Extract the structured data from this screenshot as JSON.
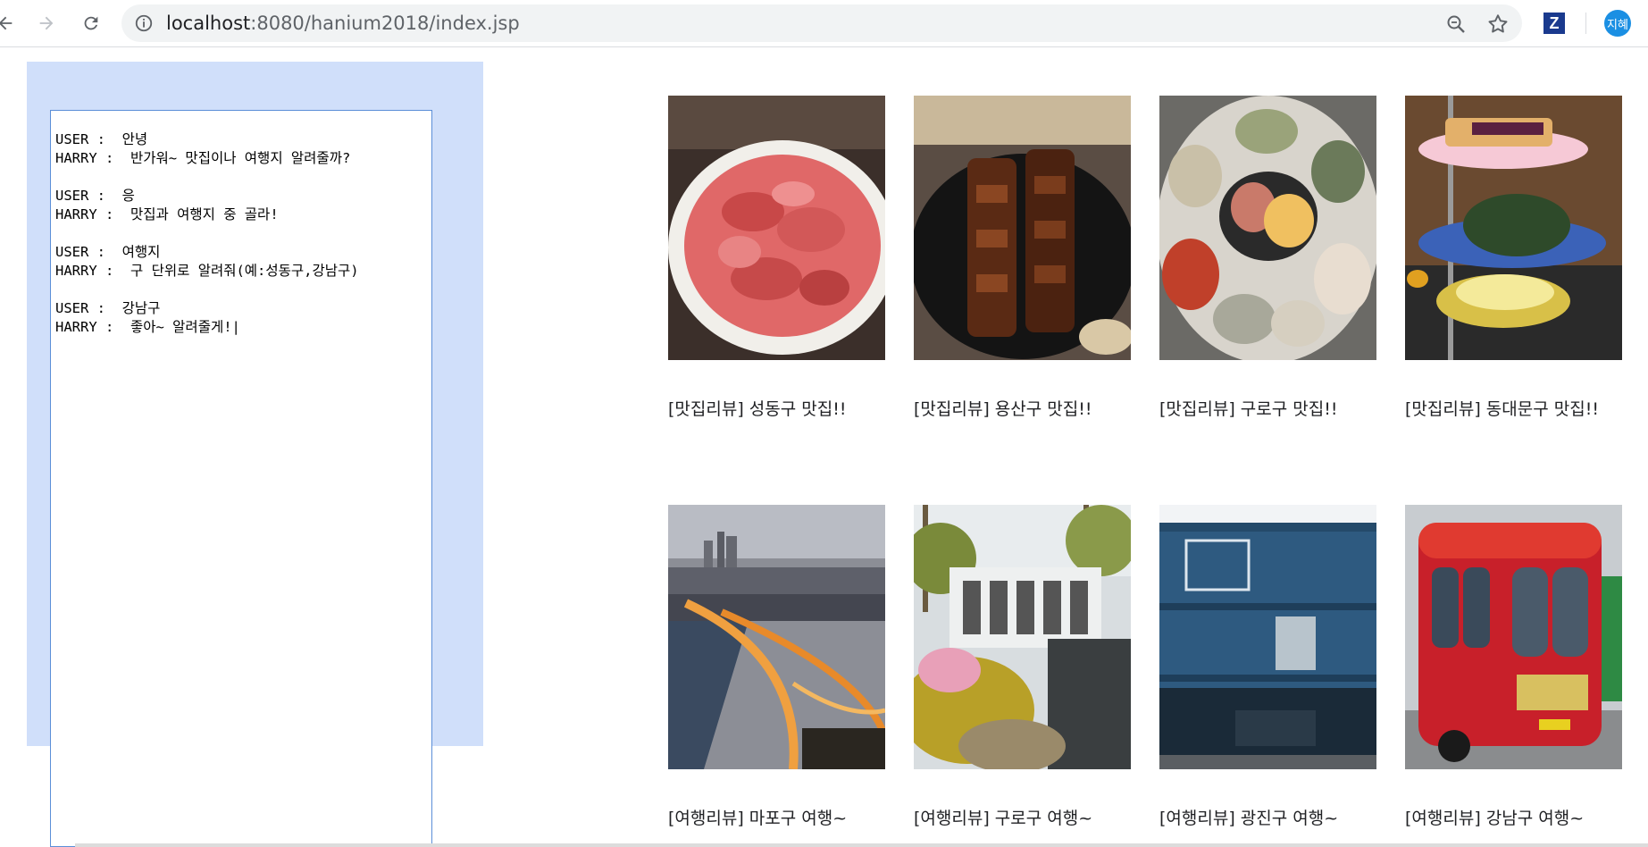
{
  "browser": {
    "url_host": "localhost",
    "url_path": ":8080/hanium2018/index.jsp",
    "extension_label": "Z",
    "profile_initials": "지혜"
  },
  "chat": {
    "lines": [
      "USER :  안녕",
      "HARRY :  반가워~ 맛집이나 여행지 알려줄까?",
      "",
      "USER :  응",
      "HARRY :  맛집과 여행지 중 골라!",
      "",
      "USER :  여행지",
      "HARRY :  구 단위로 알려줘(예:성동구,강남구)",
      "",
      "USER :  강남구",
      "HARRY :  좋아~ 알려줄게!|"
    ]
  },
  "food_reviews": [
    {
      "caption": "[맛집리뷰] 성동구 맛집!!",
      "photo": "raw-beef-plate"
    },
    {
      "caption": "[맛집리뷰] 용산구 맛집!!",
      "photo": "grilled-ribs"
    },
    {
      "caption": "[맛집리뷰] 구로구 맛집!!",
      "photo": "seafood-platter"
    },
    {
      "caption": "[맛집리뷰] 동대문구 맛집!!",
      "photo": "dessert-tower"
    }
  ],
  "travel_reviews": [
    {
      "caption": "[여행리뷰] 마포구 여행~",
      "photo": "river-night-view"
    },
    {
      "caption": "[여행리뷰] 구로구 여행~",
      "photo": "garden-sign"
    },
    {
      "caption": "[여행리뷰] 광진구 여행~",
      "photo": "container-mall"
    },
    {
      "caption": "[여행리뷰] 강남구 여행~",
      "photo": "tour-bus"
    }
  ],
  "icons": {
    "back": "back-arrow-icon",
    "forward": "forward-arrow-icon",
    "reload": "reload-icon",
    "info": "info-icon",
    "zoom": "zoom-icon",
    "star": "star-icon"
  },
  "colors": {
    "chat_panel_bg": "#d0dffa",
    "chat_border": "#5b8fd8",
    "profile": "#1a8fe3"
  }
}
